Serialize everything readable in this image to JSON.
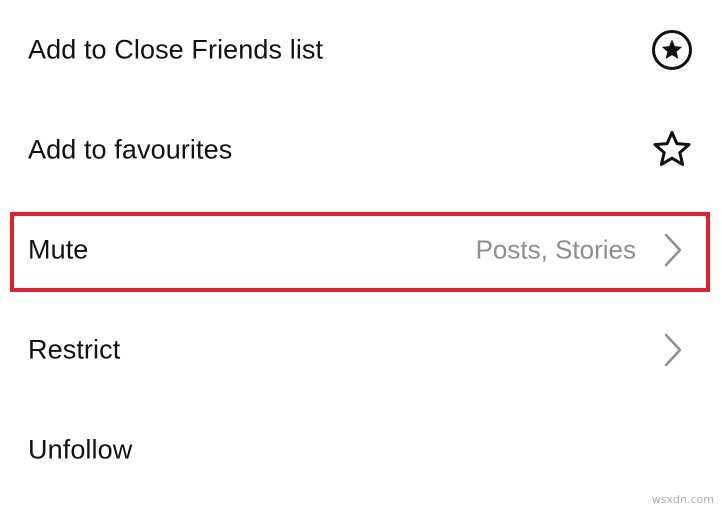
{
  "menu": {
    "items": [
      {
        "label": "Add to Close Friends list",
        "icon": "close-friends-star-circle-icon"
      },
      {
        "label": "Add to favourites",
        "icon": "star-outline-icon"
      },
      {
        "label": "Mute",
        "value": "Posts, Stories",
        "icon": "chevron-right-icon",
        "highlighted": true
      },
      {
        "label": "Restrict",
        "icon": "chevron-right-icon"
      },
      {
        "label": "Unfollow"
      }
    ]
  },
  "highlight_color": "#e3202a",
  "watermark": "wsxdn.com"
}
